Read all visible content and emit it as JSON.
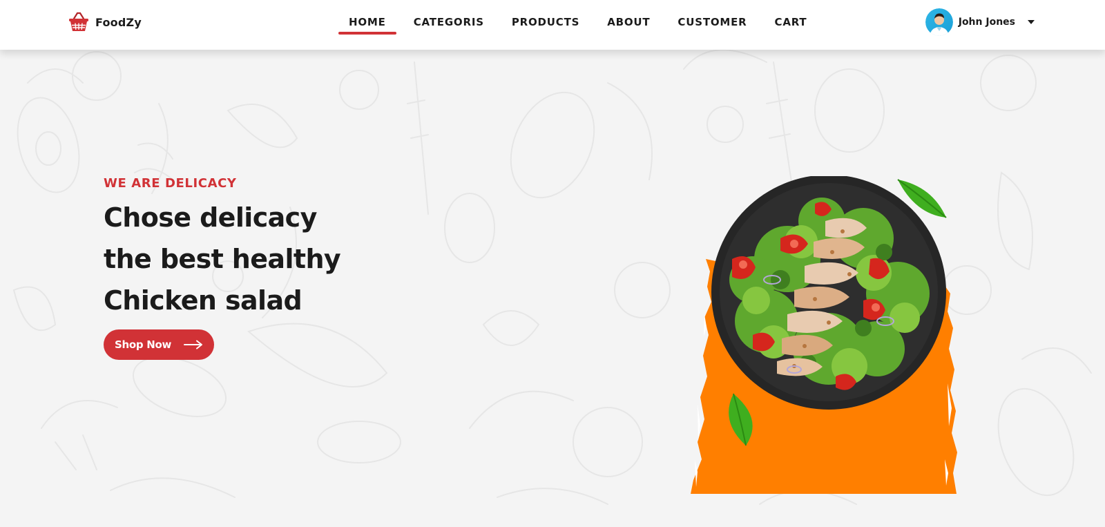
{
  "brand": {
    "name": "FoodZy",
    "icon": "basket-icon",
    "accent_color": "#d13236"
  },
  "nav": {
    "items": [
      {
        "label": "HOME",
        "active": true
      },
      {
        "label": "CATEGORIS",
        "active": false
      },
      {
        "label": "PRODUCTS",
        "active": false
      },
      {
        "label": "ABOUT",
        "active": false
      },
      {
        "label": "CUSTOMER",
        "active": false
      },
      {
        "label": "CART",
        "active": false
      }
    ],
    "active_underline_color": "#d13236"
  },
  "user": {
    "name": "John Jones",
    "avatar_icon": "avatar",
    "menu_icon": "caret-down-icon"
  },
  "hero": {
    "eyebrow": "WE ARE DELICACY",
    "headline_lines": [
      "Chose delicacy",
      "the best healthy",
      "Chicken salad"
    ],
    "cta": {
      "label": "Shop Now",
      "icon": "arrow-right-icon",
      "color": "#d13236"
    },
    "image": {
      "subject": "salad-bowl-image",
      "backdrop_color": "#ff7f00",
      "leaf_color": "#3fae1f"
    }
  },
  "colors": {
    "background": "#f4f4f4",
    "text": "#1b1b1b"
  }
}
